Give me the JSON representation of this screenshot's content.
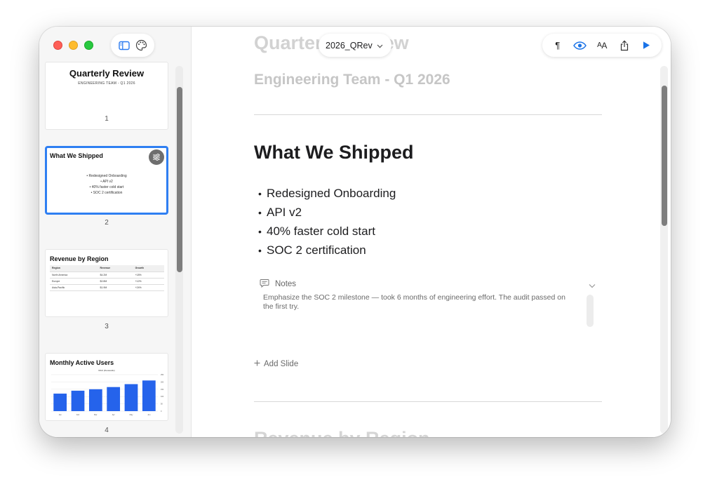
{
  "document": {
    "name": "2026_QRev"
  },
  "toolbar": {
    "sidebar_toggle_icon": "sidebar-icon",
    "theme_icon": "palette-icon",
    "right_tools": [
      "pilcrow-icon",
      "eye-icon",
      "text-size-icon",
      "share-icon",
      "play-icon"
    ],
    "text_size_label_small": "A",
    "text_size_label_large": "A",
    "pilcrow": "¶"
  },
  "thumbnails": [
    {
      "number": "1",
      "title": "Quarterly Review",
      "subtitle": "ENGINEERING TEAM - Q1 2026"
    },
    {
      "number": "2",
      "title": "What We Shipped",
      "bullets": [
        "• Redesigned Onboarding",
        "• API v2",
        "• 40% faster cold start",
        "• SOC 2 certification"
      ]
    },
    {
      "number": "3",
      "title": "Revenue by Region",
      "table": {
        "headers": [
          "Region",
          "Revenue",
          "Growth"
        ],
        "rows": [
          [
            "North America",
            "$4.2M",
            "+18%"
          ],
          [
            "Europe",
            "$2.8M",
            "+12%"
          ],
          [
            "Asia-Pacific",
            "$1.9M",
            "+24%"
          ]
        ]
      }
    },
    {
      "number": "4",
      "title": "Monthly Active Users",
      "chart_title": "MAU (thousands)"
    }
  ],
  "chart_data": {
    "type": "bar",
    "title": "MAU (thousands)",
    "categories": [
      "Jan",
      "Feb",
      "Mar",
      "Apr",
      "May",
      "Jun"
    ],
    "values": [
      120,
      140,
      150,
      165,
      185,
      210
    ],
    "ylim": [
      0,
      250
    ],
    "yticks": [
      0,
      50,
      100,
      150,
      200,
      250
    ],
    "color": "#2563eb"
  },
  "editor": {
    "prev_title": "Quarterly Review",
    "prev_subtitle": "Engineering Team - Q1 2026",
    "slide_title": "What We Shipped",
    "bullets": [
      "Redesigned Onboarding",
      "API v2",
      "40% faster cold start",
      "SOC 2 certification"
    ],
    "notes_label": "Notes",
    "notes_text": "Emphasize the SOC 2 milestone — took 6 months of engineering effort. The audit passed on the first try.",
    "add_slide_label": "Add Slide",
    "next_title": "Revenue by Region"
  },
  "colors": {
    "accent": "#2f7ff2",
    "play": "#1a73e8"
  }
}
